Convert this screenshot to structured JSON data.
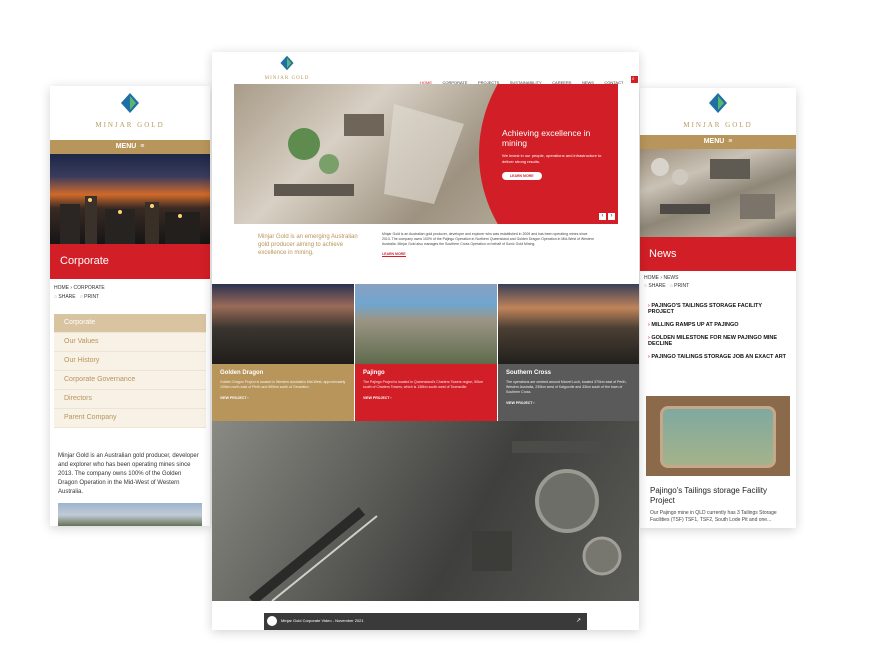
{
  "brand": {
    "name": "MINJAR GOLD",
    "gold": "#b8955a",
    "red": "#d21e26"
  },
  "left": {
    "menu_label": "MENU",
    "page_title": "Corporate",
    "breadcrumb": {
      "home": "HOME",
      "current": "CORPORATE"
    },
    "share": "SHARE",
    "print": "PRINT",
    "nav": [
      "Corporate",
      "Our Values",
      "Our History",
      "Corporate Governance",
      "Directors",
      "Parent Company"
    ],
    "about": "Minjar Gold is an Australian gold producer, developer and explorer who has been operating mines since 2013. The company owns 100% of the Golden Dragon Operation in the Mid-West of Western Australia."
  },
  "center": {
    "nav": [
      "HOME",
      "CORPORATE",
      "PROJECTS",
      "SUSTAINABILITY",
      "CAREERS",
      "NEWS",
      "CONTACT"
    ],
    "hero": {
      "title": "Achieving excellence in mining",
      "text": "We invest in our people, operations and infrastructure to deliver strong results.",
      "button": "LEARN MORE"
    },
    "intro_heading": "Minjar Gold is an emerging Australian gold producer aiming to achieve excellence in mining.",
    "intro_text": "Minjar Gold is an Australian gold producer, developer and explorer who was established in 2009 and has been operating mines since 2013. The company owns 100% of the Pajingo Operation in Northern Queensland and Golden Dragon Operation in Mid-West of Western Australia. Minjar Gold also manages the Southern Cross Operation on behalf of Sonic Gold Mining.",
    "intro_link": "LEARN MORE",
    "cards": [
      {
        "title": "Golden Dragon",
        "text": "Golden Dragon Project is located in Western Australia's Mid-West, approximately 100km north-east of Perth and 560km south of Geraldton.",
        "link": "VIEW PROJECT"
      },
      {
        "title": "Pajingo",
        "text": "The Pajingo Project is located in Queensland's Charters Towers region, 50km south of Charters Towers, which is 136km south-west of Townsville.",
        "link": "VIEW PROJECT"
      },
      {
        "title": "Southern Cross",
        "text": "The operations are centred around Marvel Loch, located 370km east of Perth, Western Australia, 230km west of Kalgoorlie and 33km south of the town of Southern Cross.",
        "link": "VIEW PROJECT"
      }
    ],
    "video_title": "Minjar Gold Corporate Video - November 2021"
  },
  "right": {
    "menu_label": "MENU",
    "page_title": "News",
    "breadcrumb": {
      "home": "HOME",
      "current": "NEWS"
    },
    "share": "SHARE",
    "print": "PRINT",
    "news": [
      "PAJINGO'S TAILINGS STORAGE FACILITY PROJECT",
      "MILLING RAMPS UP AT PAJINGO",
      "GOLDEN MILESTONE FOR NEW PAJINGO MINE DECLINE",
      "PAJINGO TAILINGS STORAGE JOB AN EXACT ART"
    ],
    "feature_title": "Pajingo's Tailings storage Facility Project",
    "feature_text": "Our Pajingo mine in QLD currently has 3 Tailings Storage Facilities (TSF) TSF1, TSF2, South Lode Pit and one..."
  }
}
